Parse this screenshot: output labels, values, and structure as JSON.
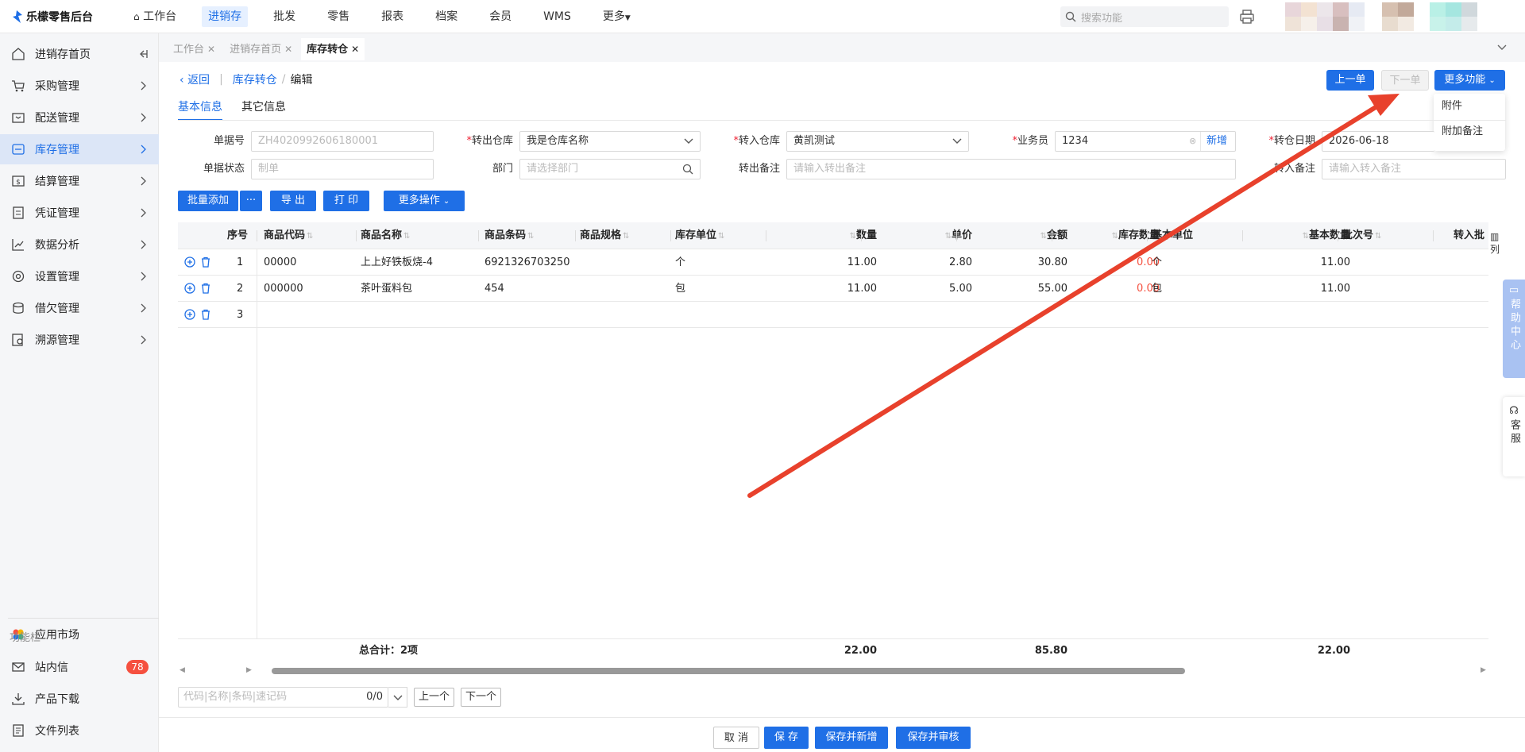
{
  "brand": {
    "name": "乐檬零售后台",
    "accent": "#1f6fe6",
    "danger": "#f5503f"
  },
  "topnav": {
    "items": [
      {
        "label": "工作台",
        "icon": "home-icon"
      },
      {
        "label": "进销存",
        "active": true
      },
      {
        "label": "批发"
      },
      {
        "label": "零售"
      },
      {
        "label": "报表"
      },
      {
        "label": "档案"
      },
      {
        "label": "会员"
      },
      {
        "label": "WMS"
      },
      {
        "label": "更多"
      }
    ],
    "search_placeholder": "搜索功能"
  },
  "sidebar": {
    "items": [
      {
        "label": "进销存首页",
        "icon": "home-icon"
      },
      {
        "label": "采购管理",
        "icon": "cart-icon"
      },
      {
        "label": "配送管理",
        "icon": "delivery-icon"
      },
      {
        "label": "库存管理",
        "icon": "inventory-icon",
        "active": true
      },
      {
        "label": "结算管理",
        "icon": "settlement-icon"
      },
      {
        "label": "凭证管理",
        "icon": "voucher-icon"
      },
      {
        "label": "数据分析",
        "icon": "chart-icon"
      },
      {
        "label": "设置管理",
        "icon": "settings-icon"
      },
      {
        "label": "借欠管理",
        "icon": "debt-icon"
      },
      {
        "label": "溯源管理",
        "icon": "trace-icon"
      }
    ],
    "app_market": "应用市场",
    "func_caption": "功能栏",
    "inbox": "站内信",
    "inbox_count": "78",
    "download": "产品下载",
    "files": "文件列表"
  },
  "page_tabs": [
    {
      "label": "工作台"
    },
    {
      "label": "进销存首页"
    },
    {
      "label": "库存转仓",
      "active": true
    }
  ],
  "breadcrumb": {
    "back": "返回",
    "parent": "库存转仓",
    "current": "编辑"
  },
  "actions": {
    "prev": "上一单",
    "next": "下一单",
    "more": "更多功能",
    "menu": [
      "附件",
      "附加备注"
    ]
  },
  "inner_tabs": [
    "基本信息",
    "其它信息"
  ],
  "form": {
    "doc_no": {
      "label": "单据号",
      "value": "ZH4020992606180001"
    },
    "out_wh": {
      "label": "转出仓库",
      "value": "我是仓库名称"
    },
    "in_wh": {
      "label": "转入仓库",
      "value": "黄凯测试"
    },
    "staff": {
      "label": "业务员",
      "value": "1234",
      "add": "新增"
    },
    "date": {
      "label": "转仓日期",
      "value": "2026-06-18"
    },
    "status": {
      "label": "单据状态",
      "value": "制单"
    },
    "dept": {
      "label": "部门",
      "placeholder": "请选择部门"
    },
    "out_note": {
      "label": "转出备注",
      "placeholder": "请输入转出备注"
    },
    "in_note": {
      "label": "转入备注",
      "placeholder": "请输入转入备注"
    }
  },
  "toolbar": {
    "batch_add": "批量添加",
    "more_dots": "···",
    "export": "导 出",
    "print": "打 印",
    "more_ops": "更多操作"
  },
  "grid": {
    "columns": [
      "序号",
      "商品代码",
      "商品名称",
      "商品条码",
      "商品规格",
      "库存单位",
      "数量",
      "单价",
      "金额",
      "库存数量",
      "基本单位",
      "基本数量",
      "批次号",
      "转入批"
    ],
    "rows": [
      {
        "no": "1",
        "code": "00000",
        "name": "上上好铁板烧-4",
        "barcode": "6921326703250",
        "spec": "",
        "unit": "个",
        "qty": "11.00",
        "price": "2.80",
        "amount": "30.80",
        "stock": "0.00",
        "base_unit": "个",
        "base_qty": "11.00",
        "batch": ""
      },
      {
        "no": "2",
        "code": "000000",
        "name": "茶叶蛋料包",
        "barcode": "454",
        "spec": "",
        "unit": "包",
        "qty": "11.00",
        "price": "5.00",
        "amount": "55.00",
        "stock": "0.00",
        "base_unit": "包",
        "base_qty": "11.00",
        "batch": ""
      },
      {
        "no": "3"
      }
    ],
    "footer": {
      "total_label": "总合计：2项",
      "qty": "22.00",
      "amount": "85.80",
      "base_qty": "22.00"
    },
    "col_toggle": "列"
  },
  "find": {
    "placeholder": "代码|名称|条码|速记码",
    "count": "0/0",
    "prev": "上一个",
    "next": "下一个"
  },
  "side_float": {
    "help": "帮助中心",
    "service": "客服"
  },
  "bottom": {
    "cancel": "取 消",
    "save": "保 存",
    "save_new": "保存并新增",
    "save_audit": "保存并审核"
  }
}
